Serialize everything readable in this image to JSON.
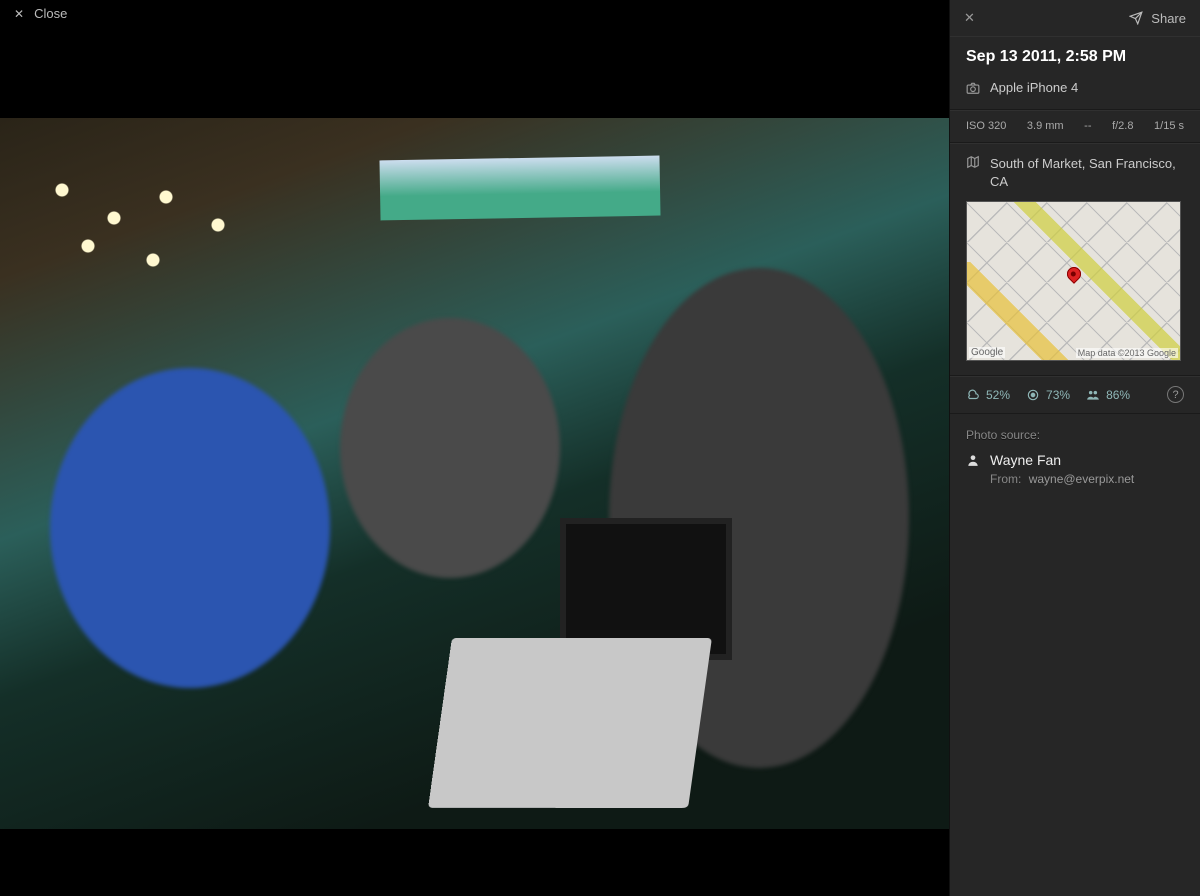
{
  "header": {
    "close_label": "Close",
    "share_label": "Share"
  },
  "details": {
    "timestamp": "Sep 13 2011, 2:58 PM",
    "camera": "Apple iPhone 4"
  },
  "exif": {
    "iso": "ISO 320",
    "focal_length": "3.9 mm",
    "exposure_bias": "--",
    "aperture": "f/2.8",
    "shutter": "1/15 s"
  },
  "location": {
    "name": "South of Market, San Francisco, CA",
    "map_attr_left": "Google",
    "map_attr_right": "Map data ©2013 Google"
  },
  "scores": {
    "score1": "52%",
    "score2": "73%",
    "score3": "86%"
  },
  "source": {
    "label": "Photo source:",
    "person": "Wayne Fan",
    "from_label": "From:",
    "from_value": "wayne@everpix.net"
  }
}
